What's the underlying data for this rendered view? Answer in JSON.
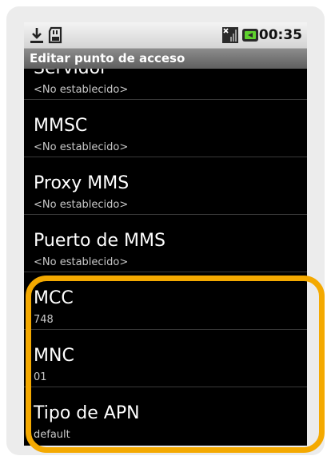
{
  "statusbar": {
    "clock": "00:35",
    "icons": [
      "download-icon",
      "sd-card-icon",
      "signal-icon",
      "battery-charging-icon"
    ]
  },
  "titlebar": {
    "title": "Editar punto de acceso"
  },
  "list": {
    "items": [
      {
        "title": "Servidor",
        "value": "<No establecido>"
      },
      {
        "title": "MMSC",
        "value": "<No establecido>"
      },
      {
        "title": "Proxy MMS",
        "value": "<No establecido>"
      },
      {
        "title": "Puerto de MMS",
        "value": "<No establecido>"
      },
      {
        "title": "MCC",
        "value": "748"
      },
      {
        "title": "MNC",
        "value": "01"
      },
      {
        "title": "Tipo de APN",
        "value": "default"
      }
    ]
  },
  "colors": {
    "highlight": "#f4a900",
    "list_background": "#000000",
    "statusbar_background": "#e0e0e0",
    "titlebar_background": "#6f6f6f"
  }
}
